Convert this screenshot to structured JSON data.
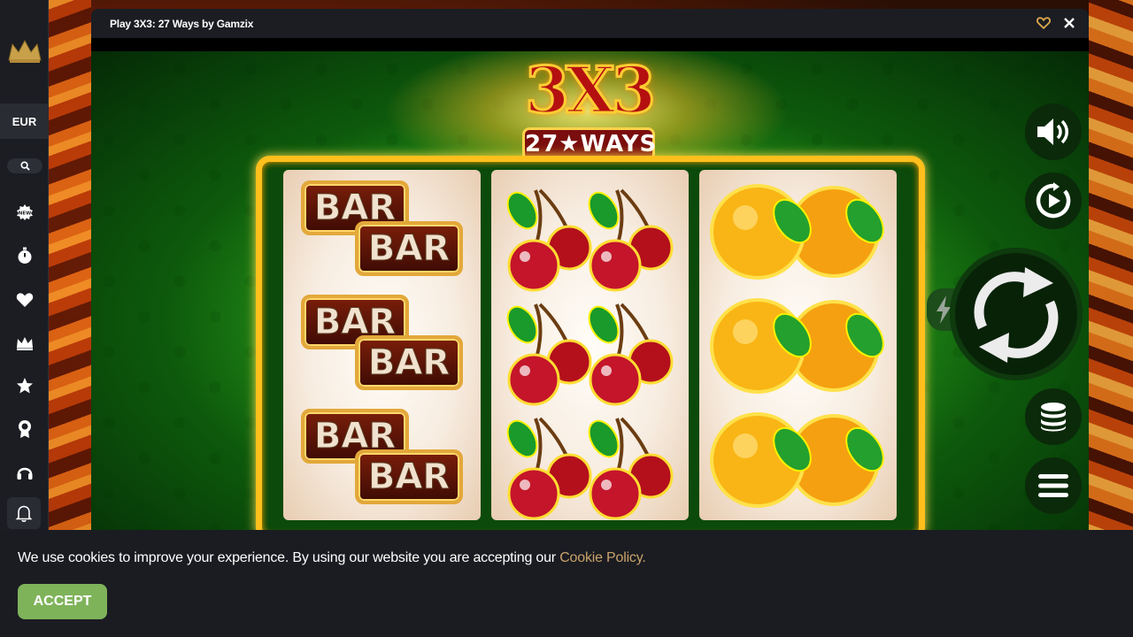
{
  "sidebar": {
    "logo_icon": "crown-logo",
    "currency": "EUR",
    "search_icon": "search-icon",
    "items": [
      {
        "name": "new-games",
        "icon": "new-badge-icon"
      },
      {
        "name": "recent",
        "icon": "stopwatch-icon"
      },
      {
        "name": "favorites",
        "icon": "heart-icon"
      },
      {
        "name": "vip",
        "icon": "crown-icon"
      },
      {
        "name": "top",
        "icon": "star-icon"
      },
      {
        "name": "achievements",
        "icon": "medal-icon"
      },
      {
        "name": "support",
        "icon": "headset-icon"
      },
      {
        "name": "notifications",
        "icon": "bell-icon"
      }
    ]
  },
  "game_window": {
    "title": "Play 3X3: 27 Ways by Gamzix",
    "favorite_icon": "heart-outline-icon",
    "close_icon": "close-icon"
  },
  "game": {
    "logo_main": "3X3",
    "logo_sub": "27★WAYS",
    "reels": [
      [
        "BAR",
        "BAR",
        "BAR"
      ],
      [
        "cherry",
        "cherry",
        "cherry"
      ],
      [
        "orange",
        "orange",
        "orange"
      ]
    ],
    "bar_text": "BAR",
    "controls": [
      "sound-icon",
      "autoplay-icon",
      "spin-icon",
      "turbo-icon",
      "bet-icon",
      "menu-icon"
    ]
  },
  "cookie_banner": {
    "text": "We use cookies to improve your experience. By using our website you are accepting our",
    "link": "Cookie Policy.",
    "button": "ACCEPT"
  },
  "colors": {
    "sidebar_bg": "#1b1d23",
    "accent_gold": "#ffbf1c",
    "accept_green": "#7fb35a",
    "link_tan": "#c9a36a"
  }
}
